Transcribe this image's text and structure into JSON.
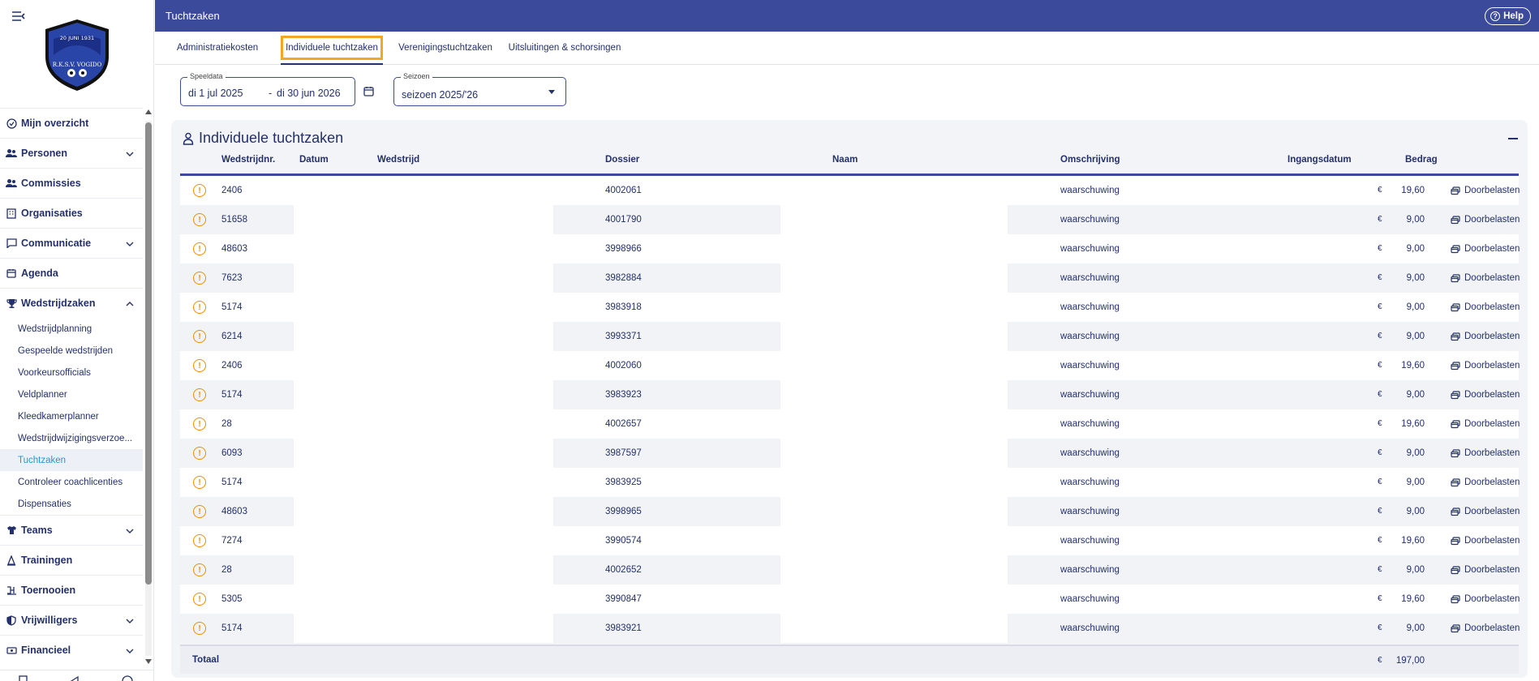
{
  "window": {
    "title": "Tuchtzaken"
  },
  "header": {
    "help_label": "Help"
  },
  "logo": {
    "text_top": "20 JUNI 1931",
    "text_arc": "R.K.S.V. VOGIDO"
  },
  "sidebar": {
    "items": [
      {
        "label": "Mijn overzicht",
        "icon": "check-circle-icon",
        "expandable": false
      },
      {
        "label": "Personen",
        "icon": "people-icon",
        "expandable": true,
        "expanded": false
      },
      {
        "label": "Commissies",
        "icon": "group-icon",
        "expandable": false
      },
      {
        "label": "Organisaties",
        "icon": "building-icon",
        "expandable": false
      },
      {
        "label": "Communicatie",
        "icon": "chat-icon",
        "expandable": true,
        "expanded": false
      },
      {
        "label": "Agenda",
        "icon": "calendar-icon",
        "expandable": false
      },
      {
        "label": "Wedstrijdzaken",
        "icon": "trophy-icon",
        "expandable": true,
        "expanded": true,
        "subitems": [
          "Wedstrijdplanning",
          "Gespeelde wedstrijden",
          "Voorkeursofficials",
          "Veldplanner",
          "Kleedkamerplanner",
          "Wedstrijdwijzigingsverzoe...",
          "Tuchtzaken",
          "Controleer coachlicenties",
          "Dispensaties"
        ],
        "active_subitem": "Tuchtzaken"
      },
      {
        "label": "Teams",
        "icon": "shirt-icon",
        "expandable": true,
        "expanded": false
      },
      {
        "label": "Trainingen",
        "icon": "cone-icon",
        "expandable": false
      },
      {
        "label": "Toernooien",
        "icon": "bracket-icon",
        "expandable": false
      },
      {
        "label": "Vrijwilligers",
        "icon": "shield-icon",
        "expandable": true,
        "expanded": false
      },
      {
        "label": "Financieel",
        "icon": "money-icon",
        "expandable": true,
        "expanded": false
      }
    ]
  },
  "tabs": [
    {
      "label": "Administratiekosten",
      "active": false
    },
    {
      "label": "Individuele tuchtzaken",
      "active": true
    },
    {
      "label": "Verenigingstuchtzaken",
      "active": false
    },
    {
      "label": "Uitsluitingen & schorsingen",
      "active": false
    }
  ],
  "filters": {
    "speeldata": {
      "legend": "Speeldata",
      "from": "di 1 jul 2025",
      "separator": "-",
      "to": "di 30 jun 2026"
    },
    "seizoen": {
      "legend": "Seizoen",
      "value": "seizoen 2025/'26"
    }
  },
  "card": {
    "title": "Individuele tuchtzaken",
    "columns": [
      "Wedstrijdnr.",
      "Datum",
      "Wedstrijd",
      "Dossier",
      "Naam",
      "Omschrijving",
      "Ingangsdatum",
      "Bedrag"
    ],
    "rows": [
      {
        "wedstrijdnr": "2406",
        "dossier": "4002061",
        "omschrijving": "waarschuwing",
        "currency": "€",
        "bedrag": "19,60",
        "action": "Doorbelasten"
      },
      {
        "wedstrijdnr": "51658",
        "dossier": "4001790",
        "omschrijving": "waarschuwing",
        "currency": "€",
        "bedrag": "9,00",
        "action": "Doorbelasten"
      },
      {
        "wedstrijdnr": "48603",
        "dossier": "3998966",
        "omschrijving": "waarschuwing",
        "currency": "€",
        "bedrag": "9,00",
        "action": "Doorbelasten"
      },
      {
        "wedstrijdnr": "7623",
        "dossier": "3982884",
        "omschrijving": "waarschuwing",
        "currency": "€",
        "bedrag": "9,00",
        "action": "Doorbelasten"
      },
      {
        "wedstrijdnr": "5174",
        "dossier": "3983918",
        "omschrijving": "waarschuwing",
        "currency": "€",
        "bedrag": "9,00",
        "action": "Doorbelasten"
      },
      {
        "wedstrijdnr": "6214",
        "dossier": "3993371",
        "omschrijving": "waarschuwing",
        "currency": "€",
        "bedrag": "9,00",
        "action": "Doorbelasten"
      },
      {
        "wedstrijdnr": "2406",
        "dossier": "4002060",
        "omschrijving": "waarschuwing",
        "currency": "€",
        "bedrag": "19,60",
        "action": "Doorbelasten"
      },
      {
        "wedstrijdnr": "5174",
        "dossier": "3983923",
        "omschrijving": "waarschuwing",
        "currency": "€",
        "bedrag": "9,00",
        "action": "Doorbelasten"
      },
      {
        "wedstrijdnr": "28",
        "dossier": "4002657",
        "omschrijving": "waarschuwing",
        "currency": "€",
        "bedrag": "19,60",
        "action": "Doorbelasten"
      },
      {
        "wedstrijdnr": "6093",
        "dossier": "3987597",
        "omschrijving": "waarschuwing",
        "currency": "€",
        "bedrag": "9,00",
        "action": "Doorbelasten"
      },
      {
        "wedstrijdnr": "5174",
        "dossier": "3983925",
        "omschrijving": "waarschuwing",
        "currency": "€",
        "bedrag": "9,00",
        "action": "Doorbelasten"
      },
      {
        "wedstrijdnr": "48603",
        "dossier": "3998965",
        "omschrijving": "waarschuwing",
        "currency": "€",
        "bedrag": "9,00",
        "action": "Doorbelasten"
      },
      {
        "wedstrijdnr": "7274",
        "dossier": "3990574",
        "omschrijving": "waarschuwing",
        "currency": "€",
        "bedrag": "19,60",
        "action": "Doorbelasten"
      },
      {
        "wedstrijdnr": "28",
        "dossier": "4002652",
        "omschrijving": "waarschuwing",
        "currency": "€",
        "bedrag": "9,00",
        "action": "Doorbelasten"
      },
      {
        "wedstrijdnr": "5305",
        "dossier": "3990847",
        "omschrijving": "waarschuwing",
        "currency": "€",
        "bedrag": "19,60",
        "action": "Doorbelasten"
      },
      {
        "wedstrijdnr": "5174",
        "dossier": "3983921",
        "omschrijving": "waarschuwing",
        "currency": "€",
        "bedrag": "9,00",
        "action": "Doorbelasten"
      }
    ],
    "total": {
      "label": "Totaal",
      "currency": "€",
      "amount": "197,00"
    }
  },
  "colors": {
    "header_bg": "#3c4a9b",
    "text": "#23306b",
    "active_sub": "#1a9bd7",
    "warning": "#f08c00",
    "tab_focus": "#f5a623"
  }
}
